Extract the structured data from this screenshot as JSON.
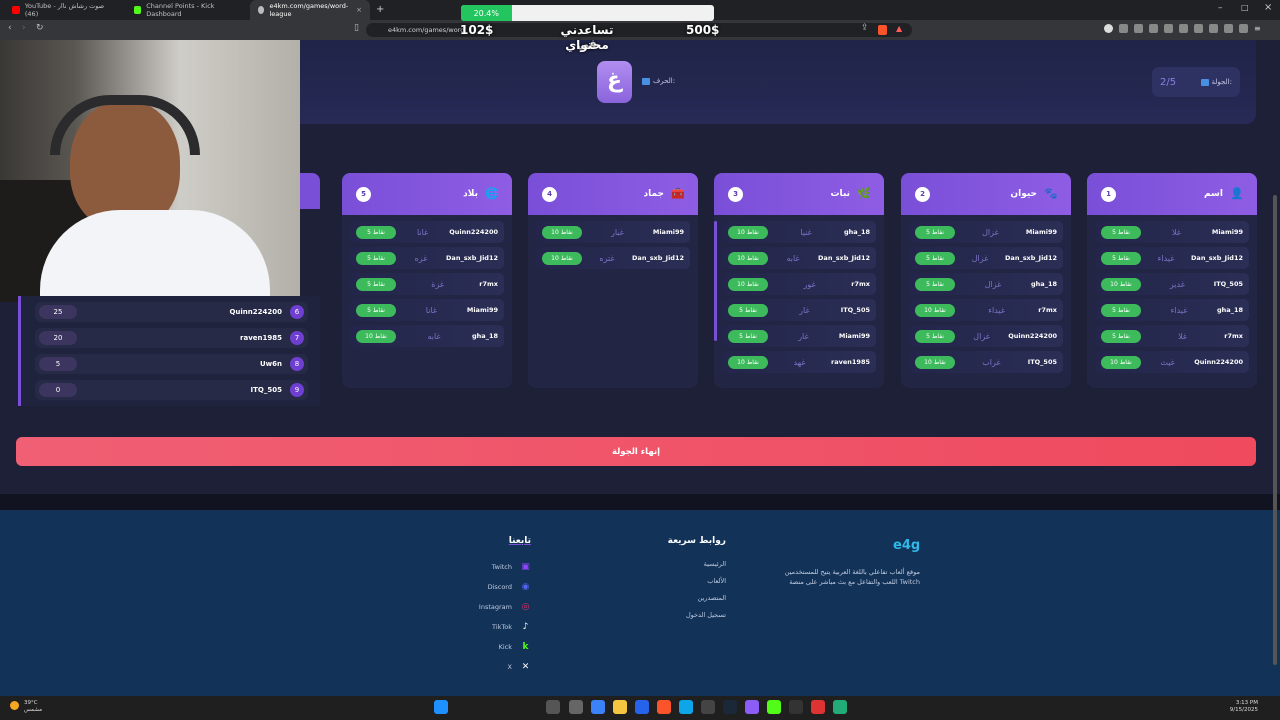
{
  "browser": {
    "tabs": [
      {
        "title": "YouTube - صوت رشاش ناار (46)",
        "fav_color": "#ff0000"
      },
      {
        "title": "Channel Points - Kick Dashboard",
        "fav_color": "#53fc18"
      },
      {
        "title": "e4km.com/games/word-league",
        "fav_color": "#bbbbbb"
      }
    ],
    "url": "e4km.com/games/word"
  },
  "overlay": {
    "progress_label": "20.4%",
    "progress_value": 0.2,
    "current_amount": "102$",
    "goal_amount": "500$",
    "support_line1": "تساعدني في",
    "support_line2": "محتواي"
  },
  "game": {
    "letter_label": "الحرف:",
    "letter": "غ",
    "round_label": "الجولة:",
    "round_value": "2/5"
  },
  "categories": [
    {
      "num": "1",
      "name": "اسم",
      "icon": "person-icon",
      "answers": [
        {
          "player": "Miami99",
          "word": "غلا",
          "points": "5 نقاط"
        },
        {
          "player": "Dan_sxb_Jid12",
          "word": "غيداء",
          "points": "5 نقاط"
        },
        {
          "player": "ITQ_505",
          "word": "غدير",
          "points": "10 نقاط"
        },
        {
          "player": "gha_18",
          "word": "غيداء",
          "points": "5 نقاط"
        },
        {
          "player": "r7mx",
          "word": "غلا",
          "points": "5 نقاط"
        },
        {
          "player": "Quinn224200",
          "word": "غيث",
          "points": "10 نقاط"
        }
      ]
    },
    {
      "num": "2",
      "name": "حيوان",
      "icon": "paw-icon",
      "answers": [
        {
          "player": "Miami99",
          "word": "غزال",
          "points": "5 نقاط"
        },
        {
          "player": "Dan_sxb_Jid12",
          "word": "غزال",
          "points": "5 نقاط"
        },
        {
          "player": "gha_18",
          "word": "غزال",
          "points": "5 نقاط"
        },
        {
          "player": "r7mx",
          "word": "غيداء",
          "points": "10 نقاط"
        },
        {
          "player": "Quinn224200",
          "word": "غزال",
          "points": "5 نقاط"
        },
        {
          "player": "ITQ_505",
          "word": "غراب",
          "points": "10 نقاط"
        }
      ]
    },
    {
      "num": "3",
      "name": "نبات",
      "icon": "leaf-icon",
      "answers": [
        {
          "player": "gha_18",
          "word": "غنيا",
          "points": "10 نقاط"
        },
        {
          "player": "Dan_sxb_Jid12",
          "word": "غابه",
          "points": "10 نقاط"
        },
        {
          "player": "r7mx",
          "word": "غور",
          "points": "10 نقاط"
        },
        {
          "player": "ITQ_505",
          "word": "غار",
          "points": "5 نقاط"
        },
        {
          "player": "Miami99",
          "word": "غار",
          "points": "5 نقاط"
        },
        {
          "player": "raven1985",
          "word": "غهد",
          "points": "10 نقاط"
        }
      ]
    },
    {
      "num": "4",
      "name": "جماد",
      "icon": "box-icon",
      "answers": [
        {
          "player": "Miami99",
          "word": "غبار",
          "points": "10 نقاط"
        },
        {
          "player": "Dan_sxb_Jid12",
          "word": "غتره",
          "points": "10 نقاط"
        }
      ]
    },
    {
      "num": "5",
      "name": "بلاد",
      "icon": "globe-icon",
      "answers": [
        {
          "player": "Quinn224200",
          "word": "غانا",
          "points": "5 نقاط"
        },
        {
          "player": "Dan_sxb_Jid12",
          "word": "غزه",
          "points": "5 نقاط"
        },
        {
          "player": "r7mx",
          "word": "غزة",
          "points": "5 نقاط"
        },
        {
          "player": "Miami99",
          "word": "غانا",
          "points": "5 نقاط"
        },
        {
          "player": "gha_18",
          "word": "غابه",
          "points": "10 نقاط"
        }
      ]
    }
  ],
  "leaderboard": [
    {
      "rank": "6",
      "name": "Quinn224200",
      "score": "25"
    },
    {
      "rank": "7",
      "name": "raven1985",
      "score": "20"
    },
    {
      "rank": "8",
      "name": "Uw6n",
      "score": "5"
    },
    {
      "rank": "9",
      "name": "ITQ_505",
      "score": "0"
    }
  ],
  "end_round_label": "إنهاء الجولة",
  "footer": {
    "brand": "e4g",
    "description_line1": "موقع ألعاب تفاعلي باللغة العربية يتيح للمستخدمين",
    "description_line2": "اللعب والتفاعل مع بث مباشر على منصة Twitch",
    "links_title": "روابط سريعة",
    "links": [
      "الرئيسية",
      "الألعاب",
      "المتصدرين",
      "تسجيل الدخول"
    ],
    "follow_title": "تابعنا",
    "social": [
      {
        "name": "Twitch",
        "icon": "twitch-icon",
        "color": "#9146ff"
      },
      {
        "name": "Discord",
        "icon": "discord-icon",
        "color": "#5865f2"
      },
      {
        "name": "Instagram",
        "icon": "instagram-icon",
        "color": "#e1306c"
      },
      {
        "name": "TikTok",
        "icon": "tiktok-icon",
        "color": "#ffffff"
      },
      {
        "name": "Kick",
        "icon": "kick-icon",
        "color": "#53fc18"
      },
      {
        "name": "X",
        "icon": "x-icon",
        "color": "#ffffff"
      }
    ]
  },
  "taskbar": {
    "weather_temp": "39°C",
    "weather_text": "مشمس",
    "time": "3:13 PM",
    "date": "9/15/2025"
  }
}
